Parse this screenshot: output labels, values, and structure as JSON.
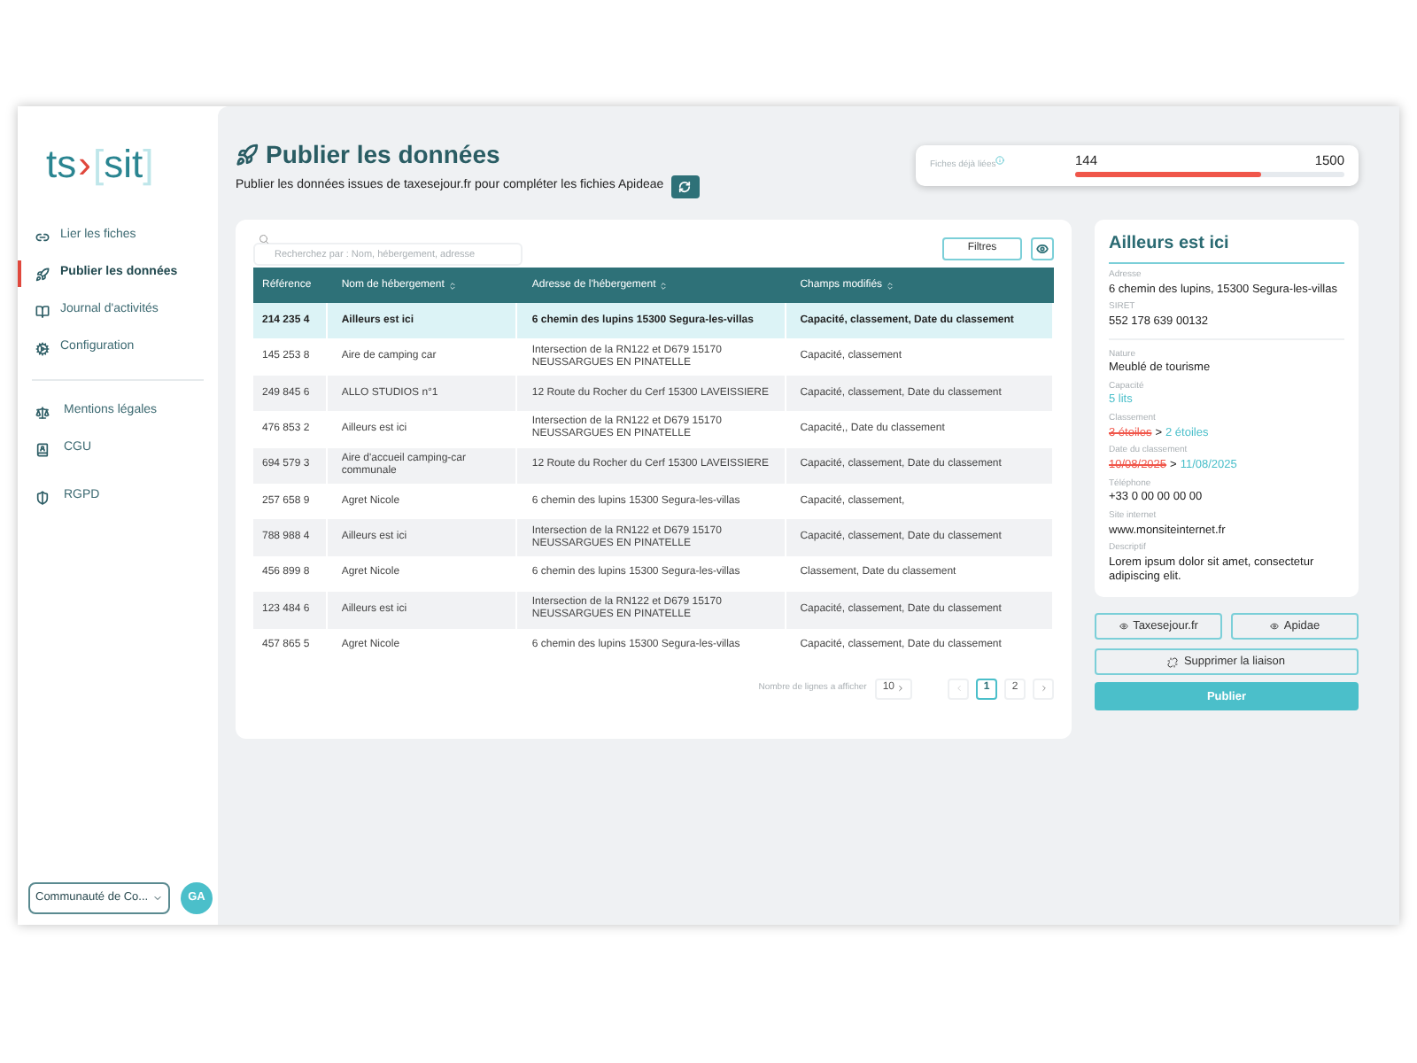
{
  "sidebar": {
    "logo": {
      "left": "ts",
      "separator": "›",
      "open_bracket": "[",
      "right": "sit",
      "close_bracket": "]"
    },
    "nav": [
      {
        "label": "Lier les fiches",
        "selected": false
      },
      {
        "label": "Publier les données",
        "selected": true
      },
      {
        "label": "Journal d'activités",
        "selected": false
      },
      {
        "label": "Configuration",
        "selected": false
      }
    ],
    "legal": [
      {
        "label": "Mentions légales"
      },
      {
        "label": "CGU"
      },
      {
        "label": "RGPD"
      }
    ],
    "organization_select": {
      "value": "Communauté de Co..."
    },
    "avatar": "GA"
  },
  "header": {
    "title": "Publier les données",
    "subtitle": "Publier les données issues de taxesejour.fr pour compléter les fichies Apideae"
  },
  "progress": {
    "label": "Fiches déjà liées",
    "current": "144",
    "total": "1500",
    "level": 0.69
  },
  "table": {
    "search": {
      "placeholder": "Recherchez par : Nom, hébergement, adresse"
    },
    "filters_button": "Filtres",
    "columns": [
      {
        "label": "Référence",
        "sortable": false
      },
      {
        "label": "Nom de hébergement",
        "sortable": true
      },
      {
        "label": "Adresse de l'hébergement",
        "sortable": true
      },
      {
        "label": "Champs modifiés",
        "sortable": true
      }
    ],
    "rows": [
      {
        "cells": [
          "214 235 4",
          "Ailleurs est ici",
          "6 chemin des lupins 15300 Segura-les-villas",
          "Capacité, classement, Date du classement"
        ],
        "selected": true
      },
      {
        "cells": [
          "145 253 8",
          "Aire de camping car",
          "Intersection de la RN122 et D679 15170 NEUSSARGUES EN PINATELLE",
          "Capacité, classement"
        ],
        "selected": false
      },
      {
        "cells": [
          "249 845 6",
          "ALLO STUDIOS n°1",
          "12 Route du Rocher du Cerf 15300 LAVEISSIERE",
          "Capacité, classement, Date du classement"
        ],
        "selected": false
      },
      {
        "cells": [
          "476 853 2",
          "Ailleurs est ici",
          "Intersection de la RN122 et D679 15170 NEUSSARGUES EN PINATELLE",
          "Capacité,, Date du classement"
        ],
        "selected": false
      },
      {
        "cells": [
          "694 579 3",
          "Aire d'accueil camping-car communale",
          "12 Route du Rocher du Cerf 15300 LAVEISSIERE",
          "Capacité, classement, Date du classement"
        ],
        "selected": false
      },
      {
        "cells": [
          "257 658 9",
          "Agret Nicole",
          "6 chemin des lupins 15300 Segura-les-villas",
          "Capacité, classement,"
        ],
        "selected": false
      },
      {
        "cells": [
          "788 988 4",
          "Ailleurs est ici",
          "Intersection de la RN122 et D679 15170 NEUSSARGUES EN PINATELLE",
          "Capacité, classement, Date du classement"
        ],
        "selected": false
      },
      {
        "cells": [
          "456 899 8",
          "Agret Nicole",
          "6 chemin des lupins 15300 Segura-les-villas",
          "Classement, Date du classement"
        ],
        "selected": false
      },
      {
        "cells": [
          "123 484 6",
          "Ailleurs est ici",
          "Intersection de la RN122 et D679 15170 NEUSSARGUES EN PINATELLE",
          "Capacité, classement, Date du classement"
        ],
        "selected": false
      },
      {
        "cells": [
          "457 865 5",
          "Agret Nicole",
          "6 chemin des lupins 15300 Segura-les-villas",
          "Capacité, classement, Date du classement"
        ],
        "selected": false
      }
    ],
    "pagination": {
      "rows_label": "Nombre de lignes a afficher",
      "page_size": "10",
      "pages": [
        {
          "label": "1",
          "selected": true
        },
        {
          "label": "2",
          "selected": false
        }
      ]
    }
  },
  "detail": {
    "title": "Ailleurs est ici",
    "fields": [
      {
        "kind": "text",
        "label": "Adresse",
        "value": "6 chemin des lupins, 15300 Segura-les-villas"
      },
      {
        "kind": "text",
        "label": "SIRET",
        "value": "552 178 639 00132"
      },
      {
        "kind": "divider"
      },
      {
        "kind": "text",
        "label": "Nature",
        "value": "Meublé de tourisme"
      },
      {
        "kind": "updated",
        "label": "Capacité",
        "value": "5 lits"
      },
      {
        "kind": "change",
        "label": "Classement",
        "old": "3 étoiles",
        "separator": ">",
        "new": "2 étoiles"
      },
      {
        "kind": "change",
        "label": "Date du classement",
        "old": "10/08/2025",
        "separator": ">",
        "new": "11/08/2025"
      },
      {
        "kind": "text",
        "label": "Téléphone",
        "value": "+33 0 00 00 00 00"
      },
      {
        "kind": "text",
        "label": "Site internet",
        "value": "www.monsiteinternet.fr"
      },
      {
        "kind": "text",
        "label": "Descriptif",
        "value": "Lorem ipsum dolor sit amet, consectetur adipiscing elit."
      }
    ],
    "view_buttons": [
      "Taxesejour.fr",
      "Apidae"
    ],
    "unlink_button": "Supprimer la liaison",
    "publish_button": "Publier"
  }
}
